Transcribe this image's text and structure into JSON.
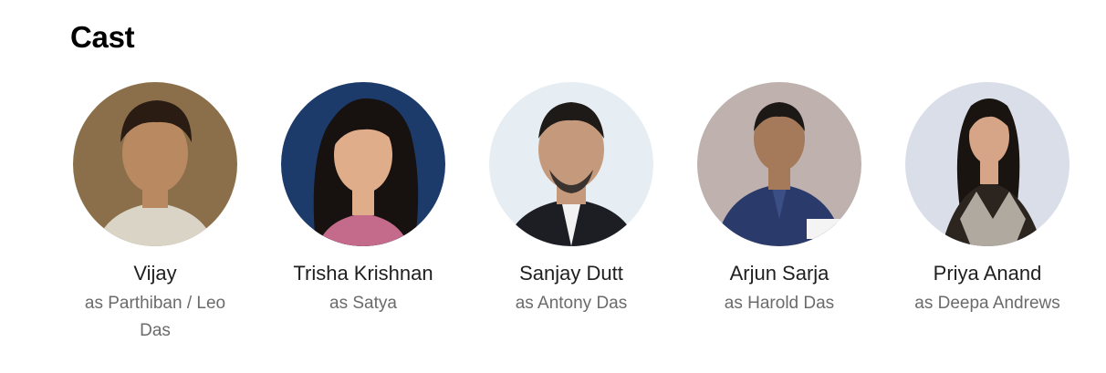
{
  "section": {
    "title": "Cast"
  },
  "cast": [
    {
      "name": "Vijay",
      "role": "as Parthiban / Leo Das",
      "photo_icon": "person-photo-icon",
      "bg_color": "#8a6f4a",
      "skin_color": "#b98a62",
      "hair_color": "#2a1c12",
      "shirt_color": "#d9d4c6"
    },
    {
      "name": "Trisha Krishnan",
      "role": "as Satya",
      "photo_icon": "person-photo-icon",
      "bg_color": "#1d3b6a",
      "skin_color": "#e0ad8a",
      "hair_color": "#17110f",
      "shirt_color": "#c46a8a"
    },
    {
      "name": "Sanjay Dutt",
      "role": "as Antony Das",
      "photo_icon": "person-photo-icon",
      "bg_color": "#e6eef3",
      "skin_color": "#c59a7c",
      "hair_color": "#1e1a18",
      "shirt_color": "#1d1d24"
    },
    {
      "name": "Arjun Sarja",
      "role": "as Harold Das",
      "photo_icon": "person-photo-icon",
      "bg_color": "#bfb1ad",
      "skin_color": "#a47a5a",
      "hair_color": "#1c1816",
      "shirt_color": "#2a3a6a"
    },
    {
      "name": "Priya Anand",
      "role": "as Deepa Andrews",
      "photo_icon": "person-photo-icon",
      "bg_color": "#d9dee8",
      "skin_color": "#d6a487",
      "hair_color": "#1a1411",
      "shirt_color": "#2b241f"
    }
  ]
}
